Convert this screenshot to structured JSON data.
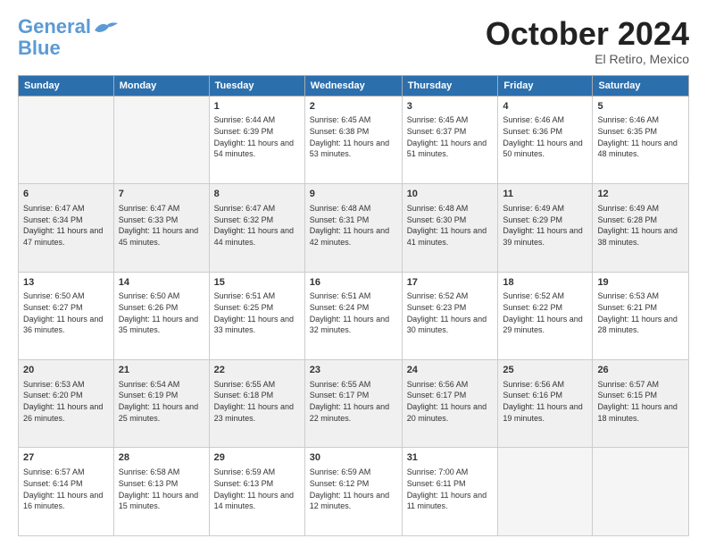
{
  "header": {
    "logo_line1": "General",
    "logo_line2": "Blue",
    "month_title": "October 2024",
    "location": "El Retiro, Mexico"
  },
  "days_of_week": [
    "Sunday",
    "Monday",
    "Tuesday",
    "Wednesday",
    "Thursday",
    "Friday",
    "Saturday"
  ],
  "weeks": [
    [
      {
        "num": "",
        "info": ""
      },
      {
        "num": "",
        "info": ""
      },
      {
        "num": "1",
        "info": "Sunrise: 6:44 AM\nSunset: 6:39 PM\nDaylight: 11 hours and 54 minutes."
      },
      {
        "num": "2",
        "info": "Sunrise: 6:45 AM\nSunset: 6:38 PM\nDaylight: 11 hours and 53 minutes."
      },
      {
        "num": "3",
        "info": "Sunrise: 6:45 AM\nSunset: 6:37 PM\nDaylight: 11 hours and 51 minutes."
      },
      {
        "num": "4",
        "info": "Sunrise: 6:46 AM\nSunset: 6:36 PM\nDaylight: 11 hours and 50 minutes."
      },
      {
        "num": "5",
        "info": "Sunrise: 6:46 AM\nSunset: 6:35 PM\nDaylight: 11 hours and 48 minutes."
      }
    ],
    [
      {
        "num": "6",
        "info": "Sunrise: 6:47 AM\nSunset: 6:34 PM\nDaylight: 11 hours and 47 minutes."
      },
      {
        "num": "7",
        "info": "Sunrise: 6:47 AM\nSunset: 6:33 PM\nDaylight: 11 hours and 45 minutes."
      },
      {
        "num": "8",
        "info": "Sunrise: 6:47 AM\nSunset: 6:32 PM\nDaylight: 11 hours and 44 minutes."
      },
      {
        "num": "9",
        "info": "Sunrise: 6:48 AM\nSunset: 6:31 PM\nDaylight: 11 hours and 42 minutes."
      },
      {
        "num": "10",
        "info": "Sunrise: 6:48 AM\nSunset: 6:30 PM\nDaylight: 11 hours and 41 minutes."
      },
      {
        "num": "11",
        "info": "Sunrise: 6:49 AM\nSunset: 6:29 PM\nDaylight: 11 hours and 39 minutes."
      },
      {
        "num": "12",
        "info": "Sunrise: 6:49 AM\nSunset: 6:28 PM\nDaylight: 11 hours and 38 minutes."
      }
    ],
    [
      {
        "num": "13",
        "info": "Sunrise: 6:50 AM\nSunset: 6:27 PM\nDaylight: 11 hours and 36 minutes."
      },
      {
        "num": "14",
        "info": "Sunrise: 6:50 AM\nSunset: 6:26 PM\nDaylight: 11 hours and 35 minutes."
      },
      {
        "num": "15",
        "info": "Sunrise: 6:51 AM\nSunset: 6:25 PM\nDaylight: 11 hours and 33 minutes."
      },
      {
        "num": "16",
        "info": "Sunrise: 6:51 AM\nSunset: 6:24 PM\nDaylight: 11 hours and 32 minutes."
      },
      {
        "num": "17",
        "info": "Sunrise: 6:52 AM\nSunset: 6:23 PM\nDaylight: 11 hours and 30 minutes."
      },
      {
        "num": "18",
        "info": "Sunrise: 6:52 AM\nSunset: 6:22 PM\nDaylight: 11 hours and 29 minutes."
      },
      {
        "num": "19",
        "info": "Sunrise: 6:53 AM\nSunset: 6:21 PM\nDaylight: 11 hours and 28 minutes."
      }
    ],
    [
      {
        "num": "20",
        "info": "Sunrise: 6:53 AM\nSunset: 6:20 PM\nDaylight: 11 hours and 26 minutes."
      },
      {
        "num": "21",
        "info": "Sunrise: 6:54 AM\nSunset: 6:19 PM\nDaylight: 11 hours and 25 minutes."
      },
      {
        "num": "22",
        "info": "Sunrise: 6:55 AM\nSunset: 6:18 PM\nDaylight: 11 hours and 23 minutes."
      },
      {
        "num": "23",
        "info": "Sunrise: 6:55 AM\nSunset: 6:17 PM\nDaylight: 11 hours and 22 minutes."
      },
      {
        "num": "24",
        "info": "Sunrise: 6:56 AM\nSunset: 6:17 PM\nDaylight: 11 hours and 20 minutes."
      },
      {
        "num": "25",
        "info": "Sunrise: 6:56 AM\nSunset: 6:16 PM\nDaylight: 11 hours and 19 minutes."
      },
      {
        "num": "26",
        "info": "Sunrise: 6:57 AM\nSunset: 6:15 PM\nDaylight: 11 hours and 18 minutes."
      }
    ],
    [
      {
        "num": "27",
        "info": "Sunrise: 6:57 AM\nSunset: 6:14 PM\nDaylight: 11 hours and 16 minutes."
      },
      {
        "num": "28",
        "info": "Sunrise: 6:58 AM\nSunset: 6:13 PM\nDaylight: 11 hours and 15 minutes."
      },
      {
        "num": "29",
        "info": "Sunrise: 6:59 AM\nSunset: 6:13 PM\nDaylight: 11 hours and 14 minutes."
      },
      {
        "num": "30",
        "info": "Sunrise: 6:59 AM\nSunset: 6:12 PM\nDaylight: 11 hours and 12 minutes."
      },
      {
        "num": "31",
        "info": "Sunrise: 7:00 AM\nSunset: 6:11 PM\nDaylight: 11 hours and 11 minutes."
      },
      {
        "num": "",
        "info": ""
      },
      {
        "num": "",
        "info": ""
      }
    ]
  ]
}
